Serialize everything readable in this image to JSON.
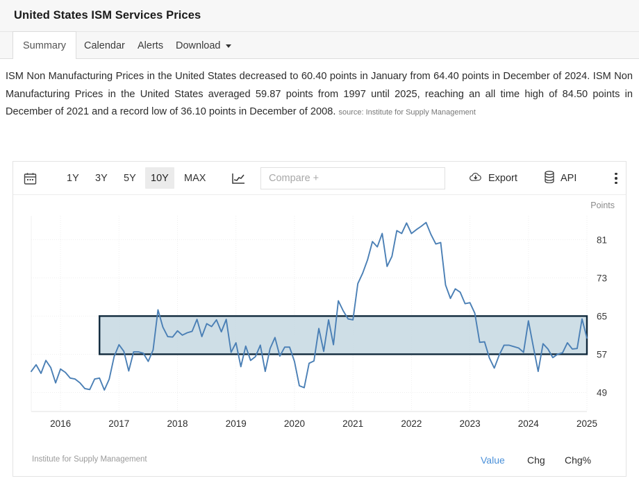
{
  "header": {
    "title": "United States ISM Services Prices"
  },
  "tabs": [
    {
      "label": "Summary",
      "active": true
    },
    {
      "label": "Calendar",
      "active": false
    },
    {
      "label": "Alerts",
      "active": false
    },
    {
      "label": "Download",
      "active": false,
      "caret": true
    }
  ],
  "description": {
    "text": "ISM Non Manufacturing Prices in the United States decreased to 60.40 points in January from 64.40 points in December of 2024. ISM Non Manufacturing Prices in the United States averaged 59.87 points from 1997 until 2025, reaching an all time high of 84.50 points in December of 2021 and a record low of 36.10 points in December of 2008.",
    "source_label": "source: Institute for Supply Management"
  },
  "toolbar": {
    "calendar_icon": "calendar-icon",
    "ranges": [
      {
        "label": "1Y",
        "active": false
      },
      {
        "label": "3Y",
        "active": false
      },
      {
        "label": "5Y",
        "active": false
      },
      {
        "label": "10Y",
        "active": true
      },
      {
        "label": "MAX",
        "active": false
      }
    ],
    "charttype_icon": "line-chart-icon",
    "compare_placeholder": "Compare +",
    "export_label": "Export",
    "export_icon": "cloud-download-icon",
    "api_label": "API",
    "api_icon": "database-icon",
    "menu_icon": "vertical-dots-icon"
  },
  "footer": {
    "source": "Institute for Supply Management",
    "tabs": [
      {
        "label": "Value",
        "active": true
      },
      {
        "label": "Chg",
        "active": false
      },
      {
        "label": "Chg%",
        "active": false
      }
    ]
  },
  "colors": {
    "line": "#4a7fb5",
    "area_fill": "#c6d8e2",
    "selection_border": "#10293c",
    "accent": "#4a90d9",
    "grid": "#eeeeee"
  },
  "chart_data": {
    "type": "line",
    "title": "United States ISM Services Prices",
    "xlabel": "",
    "ylabel": "Points",
    "ylim": [
      45,
      86
    ],
    "yticks": [
      81,
      73,
      65,
      57,
      49
    ],
    "xticks": [
      "2016",
      "2017",
      "2018",
      "2019",
      "2020",
      "2021",
      "2022",
      "2023",
      "2024",
      "2025"
    ],
    "grid": true,
    "legend": "none",
    "selection_band": {
      "ymin": 57,
      "ymax": 65,
      "xmin": "2016-09",
      "xmax": "2025-01"
    },
    "annotations": [
      "decreased to 60.40 points in January",
      "64.40 points in December of 2024",
      "all time high 84.50 in December 2021",
      "record low 36.10 in December 2008"
    ],
    "x": [
      "2015-07",
      "2015-08",
      "2015-09",
      "2015-10",
      "2015-11",
      "2015-12",
      "2016-01",
      "2016-02",
      "2016-03",
      "2016-04",
      "2016-05",
      "2016-06",
      "2016-07",
      "2016-08",
      "2016-09",
      "2016-10",
      "2016-11",
      "2016-12",
      "2017-01",
      "2017-02",
      "2017-03",
      "2017-04",
      "2017-05",
      "2017-06",
      "2017-07",
      "2017-08",
      "2017-09",
      "2017-10",
      "2017-11",
      "2017-12",
      "2018-01",
      "2018-02",
      "2018-03",
      "2018-04",
      "2018-05",
      "2018-06",
      "2018-07",
      "2018-08",
      "2018-09",
      "2018-10",
      "2018-11",
      "2018-12",
      "2019-01",
      "2019-02",
      "2019-03",
      "2019-04",
      "2019-05",
      "2019-06",
      "2019-07",
      "2019-08",
      "2019-09",
      "2019-10",
      "2019-11",
      "2019-12",
      "2020-01",
      "2020-02",
      "2020-03",
      "2020-04",
      "2020-05",
      "2020-06",
      "2020-07",
      "2020-08",
      "2020-09",
      "2020-10",
      "2020-11",
      "2020-12",
      "2021-01",
      "2021-02",
      "2021-03",
      "2021-04",
      "2021-05",
      "2021-06",
      "2021-07",
      "2021-08",
      "2021-09",
      "2021-10",
      "2021-11",
      "2021-12",
      "2022-01",
      "2022-02",
      "2022-03",
      "2022-04",
      "2022-05",
      "2022-06",
      "2022-07",
      "2022-08",
      "2022-09",
      "2022-10",
      "2022-11",
      "2022-12",
      "2023-01",
      "2023-02",
      "2023-03",
      "2023-04",
      "2023-05",
      "2023-06",
      "2023-07",
      "2023-08",
      "2023-09",
      "2023-10",
      "2023-11",
      "2023-12",
      "2024-01",
      "2024-02",
      "2024-03",
      "2024-04",
      "2024-05",
      "2024-06",
      "2024-07",
      "2024-08",
      "2024-09",
      "2024-10",
      "2024-11",
      "2024-12",
      "2025-01"
    ],
    "values": [
      53.4,
      54.8,
      53.0,
      55.7,
      54.2,
      51.0,
      53.9,
      53.2,
      52.0,
      51.8,
      51.0,
      49.8,
      49.6,
      51.8,
      52.0,
      49.5,
      51.8,
      56.5,
      59.0,
      57.6,
      53.5,
      57.5,
      57.5,
      57.2,
      55.5,
      57.9,
      66.3,
      62.7,
      60.7,
      60.6,
      61.9,
      61.0,
      61.5,
      61.8,
      64.3,
      60.7,
      63.4,
      62.8,
      64.2,
      61.7,
      64.3,
      57.4,
      59.4,
      54.4,
      58.7,
      55.7,
      56.5,
      58.9,
      53.4,
      58.2,
      60.5,
      56.6,
      58.5,
      58.5,
      55.5,
      50.4,
      50.0,
      55.1,
      55.6,
      62.4,
      57.6,
      64.2,
      59.0,
      68.2,
      66.1,
      64.4,
      64.2,
      71.8,
      74.0,
      76.8,
      80.6,
      79.5,
      82.3,
      75.4,
      77.5,
      82.9,
      82.3,
      84.5,
      82.3,
      83.1,
      83.8,
      84.6,
      82.1,
      80.1,
      80.4,
      71.5,
      68.7,
      70.7,
      70.0,
      67.6,
      67.8,
      65.6,
      59.5,
      59.6,
      56.2,
      54.1,
      56.8,
      58.9,
      58.9,
      58.6,
      58.3,
      57.4,
      64.0,
      58.6,
      53.4,
      59.2,
      58.1,
      56.3,
      57.0,
      57.3,
      59.4,
      58.1,
      58.2,
      64.4,
      60.4
    ]
  }
}
